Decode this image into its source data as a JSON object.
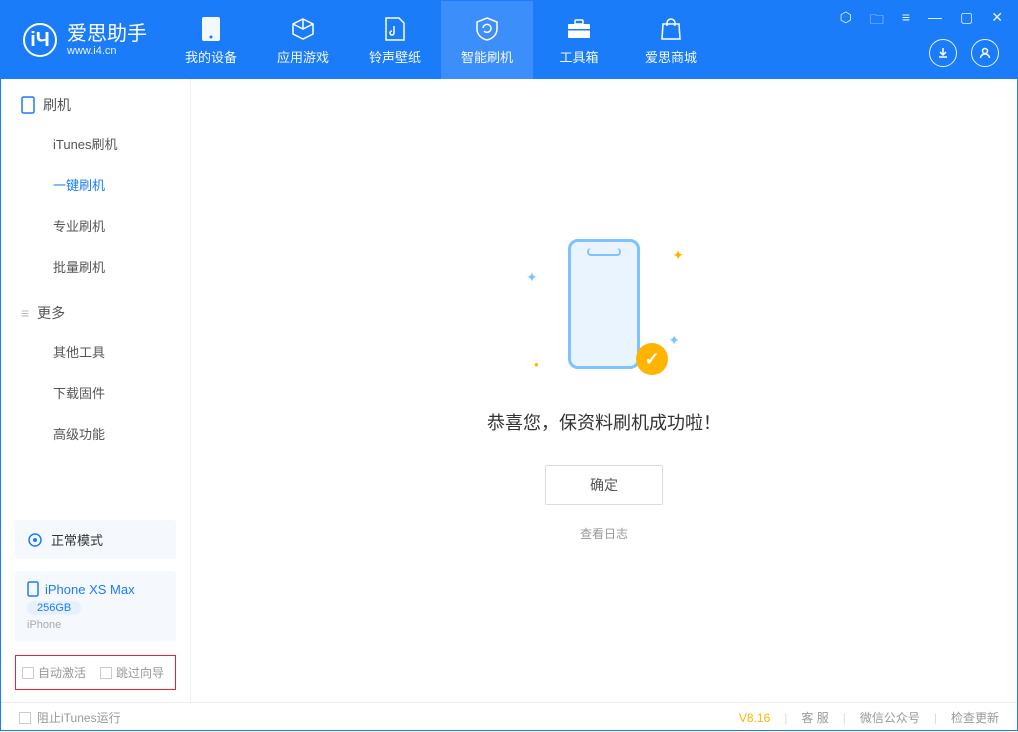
{
  "app": {
    "name": "爱思助手",
    "url": "www.i4.cn"
  },
  "nav": {
    "tabs": [
      {
        "label": "我的设备"
      },
      {
        "label": "应用游戏"
      },
      {
        "label": "铃声壁纸"
      },
      {
        "label": "智能刷机"
      },
      {
        "label": "工具箱"
      },
      {
        "label": "爱思商城"
      }
    ],
    "active_index": 3
  },
  "sidebar": {
    "section_flash": "刷机",
    "items_flash": [
      "iTunes刷机",
      "一键刷机",
      "专业刷机",
      "批量刷机"
    ],
    "active_flash_index": 1,
    "section_more": "更多",
    "items_more": [
      "其他工具",
      "下载固件",
      "高级功能"
    ]
  },
  "device": {
    "mode": "正常模式",
    "name": "iPhone XS Max",
    "capacity": "256GB",
    "type": "iPhone"
  },
  "options": {
    "auto_activate": "自动激活",
    "skip_guide": "跳过向导"
  },
  "result": {
    "title": "恭喜您，保资料刷机成功啦！",
    "ok": "确定",
    "view_log": "查看日志"
  },
  "footer": {
    "block_itunes": "阻止iTunes运行",
    "version": "V8.16",
    "support": "客 服",
    "wechat": "微信公众号",
    "update": "检查更新"
  }
}
